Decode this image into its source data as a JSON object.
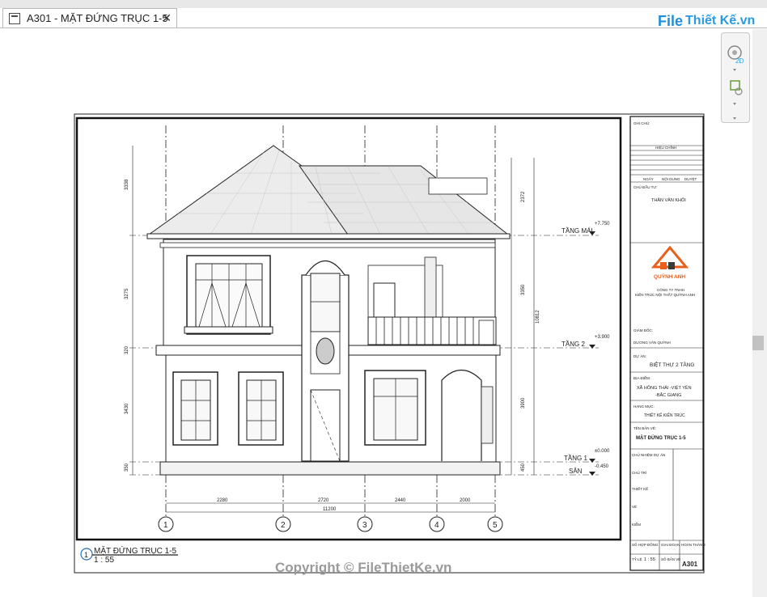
{
  "tab": {
    "title": "A301 - MẶT ĐỨNG TRỤC 1-5",
    "close_glyph": "✕"
  },
  "logo": {
    "file": "File",
    "rest": "Thiết Kế.vn"
  },
  "navbar": {
    "mode_label": "2D"
  },
  "watermark": "Copyright © FileThietKe.vn",
  "view": {
    "title": "MẶT ĐỨNG TRỤC 1-5",
    "scale": "1 : 55",
    "number": "1"
  },
  "levels": [
    {
      "name": "TẦNG MÁI",
      "elev": "+7.750"
    },
    {
      "name": "TẦNG 2",
      "elev": "+3.900"
    },
    {
      "name": "TẦNG 1",
      "elev": "±0.000"
    },
    {
      "name": "SÂN",
      "elev": "-0.450"
    }
  ],
  "grids": [
    "1",
    "2",
    "3",
    "4",
    "5"
  ],
  "dims": {
    "bottom": [
      "2280",
      "2720",
      "2440",
      "2000"
    ],
    "total": "11200",
    "left": [
      "3338",
      "3275",
      "320",
      "3430",
      "350"
    ],
    "right": [
      "2372",
      "3350",
      "10812",
      "3900",
      "450"
    ]
  },
  "titleblock": {
    "notes_label": "GHI CHÚ:",
    "revision_label": "HIỆU CHỈNH",
    "rev_cols": [
      "NGÀY",
      "NỘI DUNG",
      "DUYỆT"
    ],
    "owner_label": "CHỦ ĐẦU TƯ:",
    "owner": "THÂN VĂN KHÔI",
    "company_brand": "QUỲNH ANH",
    "company_line1": "CÔNG TY TNHH",
    "company_line2": "KIẾN TRÚC NỘI THẤT QUỲNH ANH",
    "director_label": "GIÁM ĐỐC:",
    "director": "DƯƠNG VĂN QUỲNH",
    "project_label": "DỰ ÁN:",
    "project": "BIỆT THỰ 2 TẦNG",
    "location_label": "ĐỊA ĐIỂM:",
    "location_1": "XÃ HỒNG THÁI -VIỆT YÊN",
    "location_2": "-BẮC GIANG",
    "category_label": "HẠNG MỤC:",
    "category": "THIẾT KẾ KIẾN TRÚC",
    "drawing_label": "TÊN BẢN VẼ:",
    "drawing": "MẶT ĐỨNG TRỤC 1-5",
    "manager_label": "CHỦ NHIỆM DỰ ÁN",
    "role_labels": [
      "CHỦ TRÌ",
      "THIẾT KẾ",
      "VẼ",
      "KIỂM"
    ],
    "bottom_labels": [
      "SỐ HỢP ĐỒNG",
      "GIAI ĐOẠN",
      "HOÀN THÀNH"
    ],
    "scale_label": "TỶ LỆ",
    "scale": "1 : 55",
    "sheet_label": "SỐ BẢN VẼ",
    "sheet_no": "A301"
  },
  "colors": {
    "accent": "#2a9be0",
    "logo_orange": "#e8601c",
    "ink": "#1a1a1a"
  }
}
